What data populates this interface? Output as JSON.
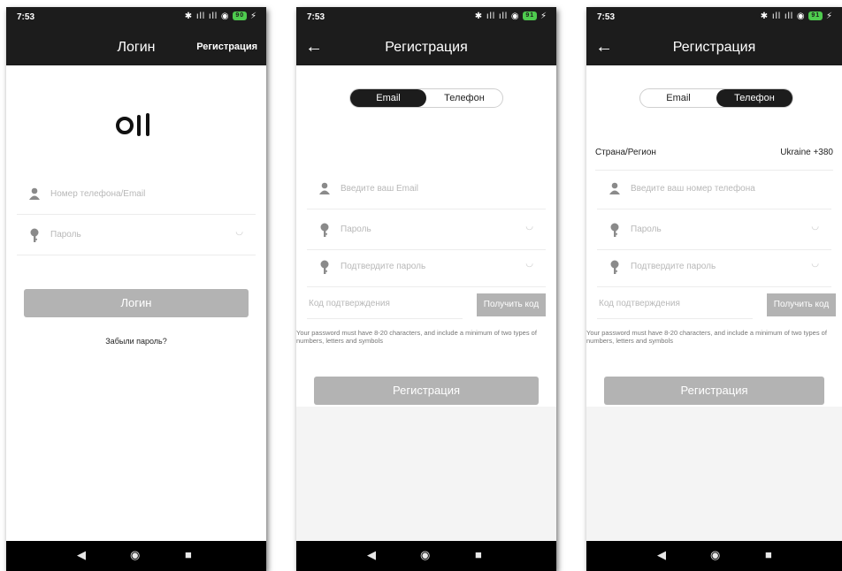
{
  "status": {
    "time": "7:53",
    "signal_icons": "✱ ıll ıll ◉",
    "battery_1": "90",
    "battery_2": "91",
    "battery_3": "91"
  },
  "login": {
    "title": "Логин",
    "register_link": "Регистрация",
    "phone_email_placeholder": "Номер телефона/Email",
    "password_placeholder": "Пароль",
    "login_button": "Логин",
    "forgot_password": "Забыли пароль?"
  },
  "register_email": {
    "title": "Регистрация",
    "tab_email": "Email",
    "tab_phone": "Телефон",
    "email_placeholder": "Введите ваш Email",
    "password_placeholder": "Пароль",
    "confirm_password_placeholder": "Подтвердите пароль",
    "code_placeholder": "Код подтверждения",
    "get_code_button": "Получить код",
    "password_hint": "Your password must have 8-20 characters, and include a minimum of two types of numbers, letters and symbols",
    "register_button": "Регистрация"
  },
  "register_phone": {
    "title": "Регистрация",
    "tab_email": "Email",
    "tab_phone": "Телефон",
    "country_label": "Страна/Регион",
    "country_value": "Ukraine +380",
    "phone_placeholder": "Введите ваш номер телефона",
    "password_placeholder": "Пароль",
    "confirm_password_placeholder": "Подтвердите пароль",
    "code_placeholder": "Код подтверждения",
    "get_code_button": "Получить код",
    "password_hint": "Your password must have 8-20 characters, and include a minimum of two types of numbers, letters and symbols",
    "register_button": "Регистрация"
  },
  "nav": {
    "back": "◀",
    "home": "◉",
    "recents": "■"
  },
  "colors": {
    "header": "#1c1c1c",
    "button_disabled": "#b3b3b3",
    "battery": "#4ecb4e",
    "navbar": "#000000"
  }
}
